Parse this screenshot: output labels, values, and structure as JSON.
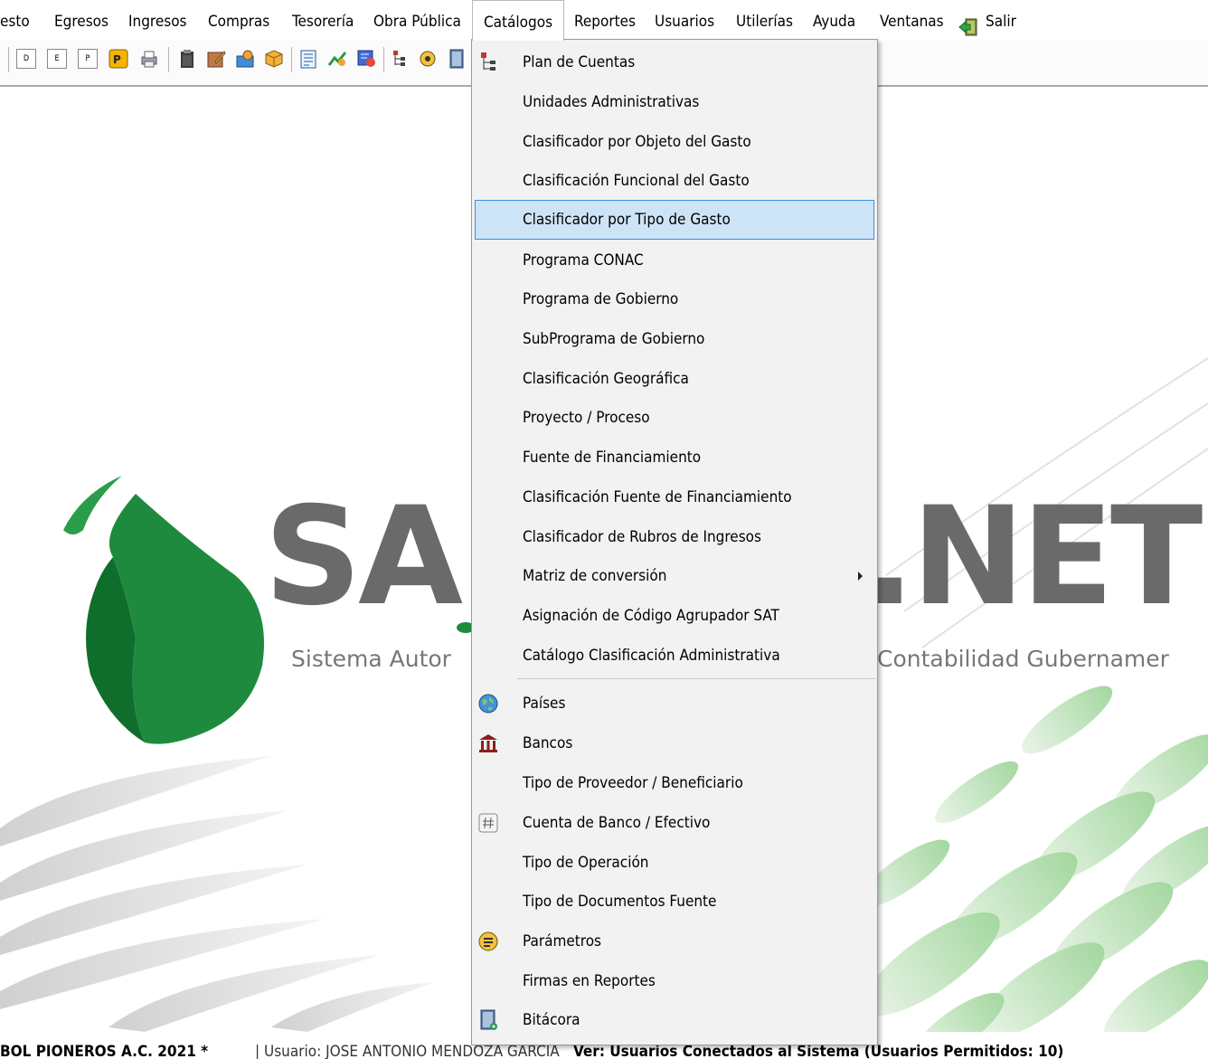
{
  "menubar": {
    "items": [
      {
        "label": "esto"
      },
      {
        "label": "Egresos"
      },
      {
        "label": "Ingresos"
      },
      {
        "label": "Compras"
      },
      {
        "label": "Tesorería"
      },
      {
        "label": "Obra Pública"
      },
      {
        "label": "Catálogos"
      },
      {
        "label": "Reportes"
      },
      {
        "label": "Usuarios"
      },
      {
        "label": "Utilerías"
      },
      {
        "label": "Ayuda"
      },
      {
        "label": "Ventanas"
      },
      {
        "label": "Salir",
        "icon": "exit-door-icon"
      }
    ],
    "open_item": "Catálogos"
  },
  "toolbar": {
    "buttons": [
      {
        "label": "D"
      },
      {
        "label": "E"
      },
      {
        "label": "P"
      },
      {
        "icon": "p-doc-icon"
      },
      {
        "icon": "printer-icon"
      },
      {
        "icon": "clipboard-icon"
      },
      {
        "icon": "notepad-icon"
      },
      {
        "icon": "user-card-icon"
      },
      {
        "icon": "box-icon"
      },
      {
        "icon": "list-doc-icon"
      },
      {
        "icon": "chart-icon"
      },
      {
        "icon": "report-icon"
      },
      {
        "icon": "tree-icon"
      },
      {
        "icon": "settings-icon"
      },
      {
        "icon": "book-icon"
      }
    ]
  },
  "background": {
    "logo_text_left": "SA",
    "logo_text_right": ".NET",
    "tagline_left": "Sistema Autor",
    "tagline_right": "Contabilidad Gubernamer"
  },
  "catalogos_menu": {
    "items": [
      {
        "label": "Plan de Cuentas",
        "icon": "tree-icon"
      },
      {
        "label": "Unidades Administrativas"
      },
      {
        "label": "Clasificador por Objeto del Gasto"
      },
      {
        "label": "Clasificación Funcional del Gasto"
      },
      {
        "label": "Clasificador por Tipo de Gasto",
        "highlighted": true
      },
      {
        "label": "Programa CONAC"
      },
      {
        "label": "Programa de Gobierno"
      },
      {
        "label": "SubPrograma de Gobierno"
      },
      {
        "label": "Clasificación Geográfica"
      },
      {
        "label": "Proyecto / Proceso"
      },
      {
        "label": "Fuente de Financiamiento"
      },
      {
        "label": "Clasificación Fuente de Financiamiento"
      },
      {
        "label": "Clasificador de Rubros de Ingresos"
      },
      {
        "label": "Matriz de conversión",
        "submenu": true
      },
      {
        "label": "Asignación de Código Agrupador SAT"
      },
      {
        "label": "Catálogo Clasificación Administrativa"
      },
      {
        "label": "Países",
        "icon": "globe-icon"
      },
      {
        "label": "Bancos",
        "icon": "bank-icon"
      },
      {
        "label": "Tipo de Proveedor / Beneficiario"
      },
      {
        "label": "Cuenta de Banco / Efectivo",
        "icon": "hash-icon"
      },
      {
        "label": "Tipo de Operación"
      },
      {
        "label": "Tipo de Documentos Fuente"
      },
      {
        "label": "Parámetros",
        "icon": "parameters-icon"
      },
      {
        "label": "Firmas en Reportes"
      },
      {
        "label": "Bitácora",
        "icon": "log-book-icon"
      }
    ]
  },
  "statusbar": {
    "company": "BOL PIONEROS A.C.  2021   *",
    "user": "| Usuario: JOSE ANTONIO MENDOZA GARCIA",
    "connected": "Ver: Usuarios Conectados al Sistema   (Usuarios Permitidos: 10)"
  },
  "colors": {
    "highlight_bg": "#cde4f7",
    "highlight_border": "#3d8fd8",
    "logo_green": "#1e8a3e",
    "logo_gray": "#6a6a6a"
  }
}
